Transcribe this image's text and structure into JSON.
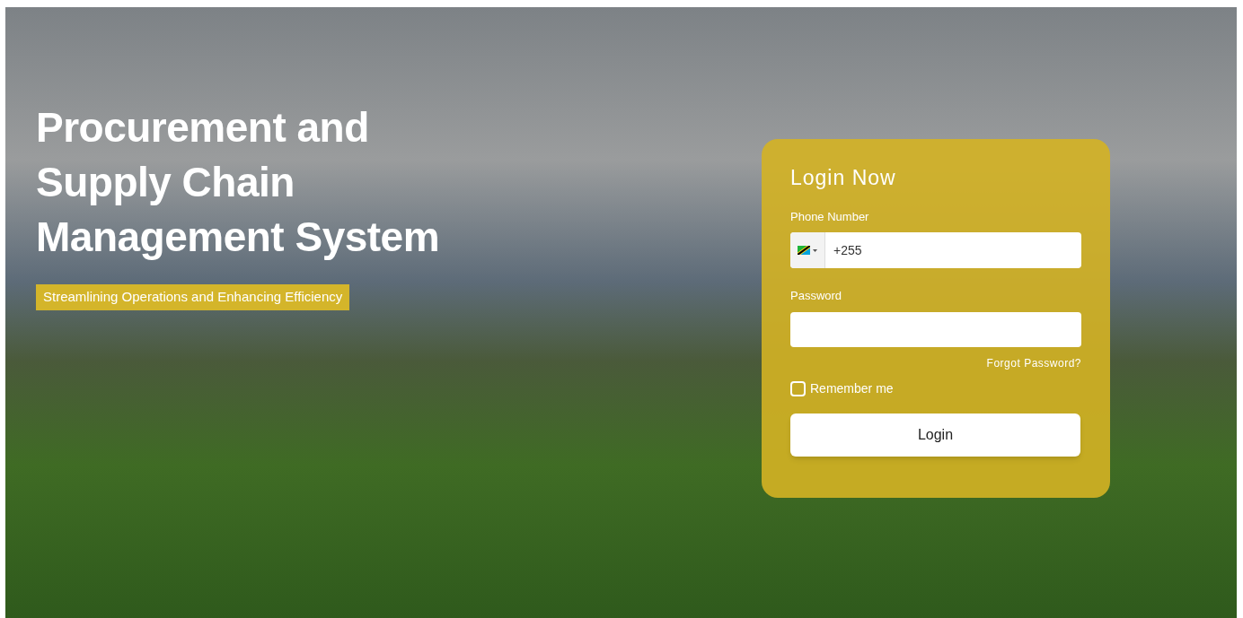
{
  "hero": {
    "title_lines": [
      "Procurement and",
      "Supply Chain",
      "Management System"
    ],
    "tagline": "Streamlining Operations and Enhancing Efficiency"
  },
  "login": {
    "title": "Login Now",
    "phone": {
      "label": "Phone Number",
      "value": "+255"
    },
    "password": {
      "label": "Password"
    },
    "forgot_link": "Forgot Password?",
    "remember": {
      "label": "Remember me",
      "checked": false
    },
    "submit": "Login"
  }
}
